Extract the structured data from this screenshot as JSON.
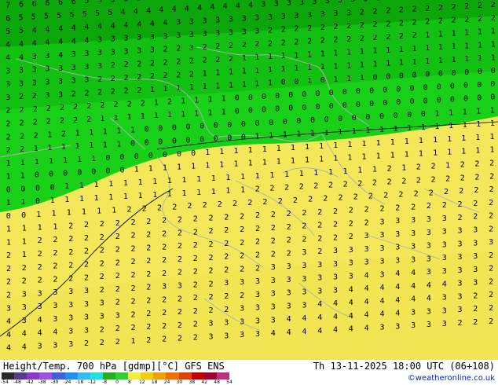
{
  "map": {
    "title": "Height/Temp. 700 hPa [gdmp][°C] GFS ENS",
    "valid_time": "Th 13-11-2025 18:00 UTC (06+108)",
    "credit": "©weatheronline.co.uk",
    "colors": {
      "dark_green": "#0aa60a",
      "green": "#12c012",
      "light_green": "#18d018",
      "yellow": "#f4e85a",
      "yellow_warm": "#f0e24e",
      "border": "#b0b0b0",
      "contour": "#000000",
      "label": "#000000"
    },
    "temperature_rows": [
      "7 6 6 6 6 6 5 5 5 5 5 5 4 4 4 4 4 4 4 4 4 4 4 4 4 4 4 4 4 4 4 4 4 4 4 4 4 4",
      "6 5 5 5 5 5 5 5 5 4 4 4 4 4 4 4 4 4 4 4 3 3 3 3 3 3 3 3 3 3 3 3 3 3 3 3 3 3 3",
      "5 5 4 4 4 4 4 4 4 4 4 4 4 3 3 3 3 3 3 3 3 3 3 3 3 3 3 2 2 2 2 2 2 2 2 2 2 2",
      "4 4 4 4 4 4 4 3 3 3 3 3 3 3 3 3 3 3 3 3 2 2 2 2 2 2 2 2 2 2 2 2 2 2 2 2 2 2",
      "4 4 3 3 4 3 3 3 3 3 3 3 2 2 3 2 2 2 2 2 2 2 2 2 2 2 2 2 2 2 2 2 1 1 1 1 1 1",
      "3 3 3 3 3 3 3 3 2 2 2 2 2 2 2 2 2 2 1 1 1 1 1 1 1 1 1 1 1 1 1 1 1 1 1 1 1 1",
      "3 3 3 3 3 3 3 2 2 2 2 2 2 2 2 1 1 1 1 1 1 1 1 1 1 1 1 1 1 1 1 1 1 1 1 1 1 1",
      "3 2 2 3 3 2 2 2 2 2 2 1 1 1 1 1 1 1 1 1 1 0 0 1 0 1 1 1 0 0 0 0 0 0 0 0 0 0",
      "2 2 2 2 2 2 2 2 2 2 2 1 2 1 1 1 1 0 0 0 0 0 0 0 0 0 0 0 0 0 0 0 0 0 0 0 0",
      "2 2 2 2 2 2 2 1 1 1 1 1 1 1 1 1 1 0 0 0 0 0 0 0 0 0 0 0 0 0 0 0 0 0 0 0 0",
      "2 2 2 1 2 1 1 1 1 1 0 0 0 0 0 0 0 0 0 0 0 0 0 0 0 0 0 0 0 0 0 1 1 1 1 1",
      "2 2 1 1 1 1 1 1 1 0 0 0 0 0 0 0 0 0 1 1 1 1 1 1 1 1 1 1 1 1 1 1 1 1 1 1",
      "1 1 1 1 1 1 1 0 0 0 0 0 0 0 1 1 1 1 1 1 1 1 1 1 1 1 1 1 1 1 1 1 1 1 1",
      "1 1 0 0 0 0 0 0 0 1 1 1 1 1 1 1 1 1 1 1 1 1 1 1 1 1 1 1 1 1 1 1 1 1 1",
      "0 0 0 0 1 1 1 1 1 1 1 1 1 1 1 1 1 1 1 1 1 1 1 1 1 1 2 1 2 2 1 2 2 2",
      "1 1 0 1 1 1 1 1 1 1 1 1 1 1 1 1 1 2 2 2 2 2 2 2 2 2 2 2 2 2 2 2 2 2",
      "0 0 1 1 1 1 1 1 2 2 2 2 2 2 2 2 2 2 2 2 2 2 2 2 2 2 2 2 2 2 2 2 2",
      "1 1 1 1 2 2 2 2 2 2 2 2 2 2 2 2 2 2 2 2 2 2 2 2 2 2 2 2 2 2 2 2",
      "1 1 2 2 2 2 2 2 2 2 2 2 2 2 2 2 2 2 2 2 2 2 2 2 3 3 3 3 3 2 2 2",
      "2 1 2 2 2 2 2 2 2 2 2 2 2 2 2 2 2 2 2 2 2 2 2 3 3 3 3 3 3 3 3 2",
      "2 2 2 2 2 2 2 2 2 2 2 2 2 2 2 2 2 2 2 3 2 3 3 3 3 3 3 3 3 3 3 3",
      "2 2 2 2 2 2 2 2 2 2 2 2 2 2 2 2 2 3 3 3 3 3 3 3 3 3 3 3 3 3 3 2",
      "2 3 3 3 3 3 2 2 2 2 3 3 2 2 3 3 3 3 3 3 3 3 3 4 3 4 4 3 3 3 3 2",
      "3 3 3 3 3 3 3 2 2 2 2 2 2 2 2 2 3 3 3 3 3 3 4 4 4 4 4 4 4 3 3 2",
      "4 3 4 3 3 3 3 3 2 2 2 2 2 2 2 3 3 3 3 3 4 4 4 4 4 4 4 4 3 3 2 2",
      "4 4 4 4 3 3 2 2 2 2 2 2 2 3 3 3 3 3 4 4 4 4 4 4 4 4 3 3 3 3 2 2",
      "4 4 3 3 3 2 2 2 1 2 2 2 2 3 3 3 3 4 4 4 4 4 4 4 3 3 3 3 3 2 2 2"
    ],
    "scale": {
      "ticks": [
        "-54",
        "-48",
        "-42",
        "-38",
        "-30",
        "-24",
        "-18",
        "-12",
        "-8",
        "0",
        "8",
        "12",
        "18",
        "24",
        "30",
        "38",
        "42",
        "48",
        "54"
      ],
      "colors": [
        "#2a2a2a",
        "#5a3a8a",
        "#8a3ac8",
        "#a050e0",
        "#4060e0",
        "#2090f0",
        "#30c0f0",
        "#20e0e0",
        "#20b020",
        "#30d030",
        "#f0f040",
        "#f0d000",
        "#f0a000",
        "#f07000",
        "#e04000",
        "#c00000",
        "#a00030",
        "#c03080"
      ]
    }
  }
}
